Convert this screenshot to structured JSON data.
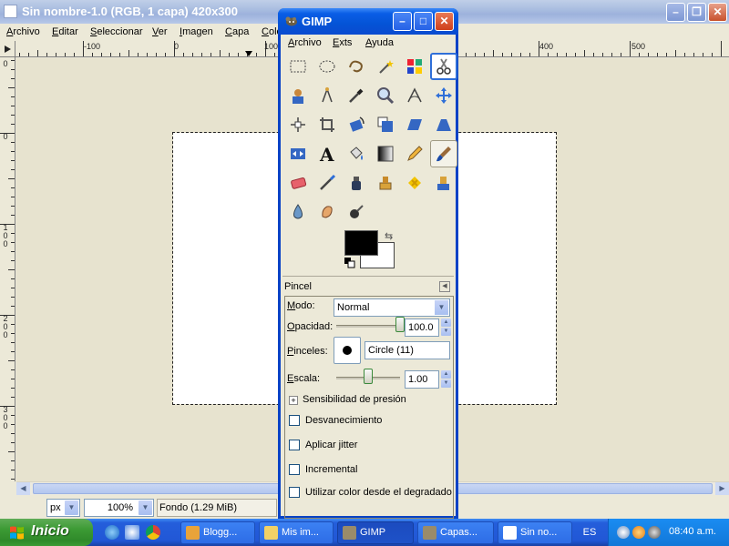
{
  "image_window": {
    "title": "Sin nombre-1.0 (RGB, 1 capa) 420x300",
    "menu": [
      "Archivo",
      "Editar",
      "Seleccionar",
      "Ver",
      "Imagen",
      "Capa",
      "Colo"
    ],
    "ruler_top_labels": [
      "-100",
      "0",
      "100",
      "400",
      "500"
    ],
    "ruler_left_labels": [
      "0",
      "0",
      "1\n0\n0",
      "2\n0\n0",
      "3\n0\n0"
    ],
    "unit": "px",
    "zoom": "100%",
    "status": "Fondo (1.29 MiB)"
  },
  "toolbox": {
    "title": "GIMP",
    "menu": [
      "Archivo",
      "Exts",
      "Ayuda"
    ],
    "tools": [
      {
        "name": "rect-select-icon",
        "row": 0,
        "col": 0
      },
      {
        "name": "ellipse-select-icon",
        "row": 0,
        "col": 1
      },
      {
        "name": "free-select-icon",
        "row": 0,
        "col": 2
      },
      {
        "name": "fuzzy-select-icon",
        "row": 0,
        "col": 3
      },
      {
        "name": "color-select-icon",
        "row": 0,
        "col": 4
      },
      {
        "name": "scissors-select-icon",
        "row": 0,
        "col": 5,
        "selected": true
      },
      {
        "name": "foreground-select-icon",
        "row": 1,
        "col": 0
      },
      {
        "name": "paths-icon",
        "row": 1,
        "col": 1
      },
      {
        "name": "color-picker-icon",
        "row": 1,
        "col": 2
      },
      {
        "name": "zoom-icon",
        "row": 1,
        "col": 3
      },
      {
        "name": "measure-icon",
        "row": 1,
        "col": 4
      },
      {
        "name": "move-icon",
        "row": 1,
        "col": 5
      },
      {
        "name": "align-icon",
        "row": 2,
        "col": 0
      },
      {
        "name": "crop-icon",
        "row": 2,
        "col": 1
      },
      {
        "name": "rotate-icon",
        "row": 2,
        "col": 2
      },
      {
        "name": "scale-icon",
        "row": 2,
        "col": 3
      },
      {
        "name": "shear-icon",
        "row": 2,
        "col": 4
      },
      {
        "name": "perspective-icon",
        "row": 2,
        "col": 5
      },
      {
        "name": "flip-icon",
        "row": 3,
        "col": 0
      },
      {
        "name": "text-icon",
        "row": 3,
        "col": 1
      },
      {
        "name": "bucket-fill-icon",
        "row": 3,
        "col": 2
      },
      {
        "name": "blend-icon",
        "row": 3,
        "col": 3
      },
      {
        "name": "pencil-icon",
        "row": 3,
        "col": 4
      },
      {
        "name": "paintbrush-icon",
        "row": 3,
        "col": 5,
        "active": true
      },
      {
        "name": "eraser-icon",
        "row": 4,
        "col": 0
      },
      {
        "name": "airbrush-icon",
        "row": 4,
        "col": 1
      },
      {
        "name": "ink-icon",
        "row": 4,
        "col": 2
      },
      {
        "name": "clone-icon",
        "row": 4,
        "col": 3
      },
      {
        "name": "heal-icon",
        "row": 4,
        "col": 4
      },
      {
        "name": "perspective-clone-icon",
        "row": 4,
        "col": 5
      },
      {
        "name": "blur-sharpen-icon",
        "row": 5,
        "col": 0
      },
      {
        "name": "smudge-icon",
        "row": 5,
        "col": 1
      },
      {
        "name": "dodge-burn-icon",
        "row": 5,
        "col": 2
      }
    ],
    "fg_color": "#000000",
    "bg_color": "#ffffff",
    "options": {
      "header": "Pincel",
      "mode_label": "Modo:",
      "mode_value": "Normal",
      "opacity_label": "Opacidad:",
      "opacity_value": "100.0",
      "opacity_level": 1.0,
      "brush_label": "Pinceles:",
      "brush_value": "Circle (11)",
      "scale_label": "Escala:",
      "scale_value": "1.00",
      "scale_level": 0.5,
      "pressure_label": "Sensibilidad de presión",
      "checkboxes": [
        {
          "label": "Desvanecimiento",
          "checked": false
        },
        {
          "label": "Aplicar jitter",
          "checked": false
        },
        {
          "label": "Incremental",
          "checked": false
        },
        {
          "label": "Utilizar color desde el degradado",
          "checked": false
        }
      ]
    }
  },
  "taskbar": {
    "start_label": "Inicio",
    "tasks": [
      {
        "label": "Blogg...",
        "active": false,
        "icon_color": "#e8a33a"
      },
      {
        "label": "Mis im...",
        "active": false,
        "icon_color": "#f2d166"
      },
      {
        "label": "GIMP",
        "active": true,
        "icon_color": "#9a8b6a"
      },
      {
        "label": "Capas...",
        "active": false,
        "icon_color": "#9a8b6a"
      },
      {
        "label": "Sin no...",
        "active": false,
        "icon_color": "#ffffff"
      }
    ],
    "language": "ES",
    "clock": "08:40 a.m."
  }
}
